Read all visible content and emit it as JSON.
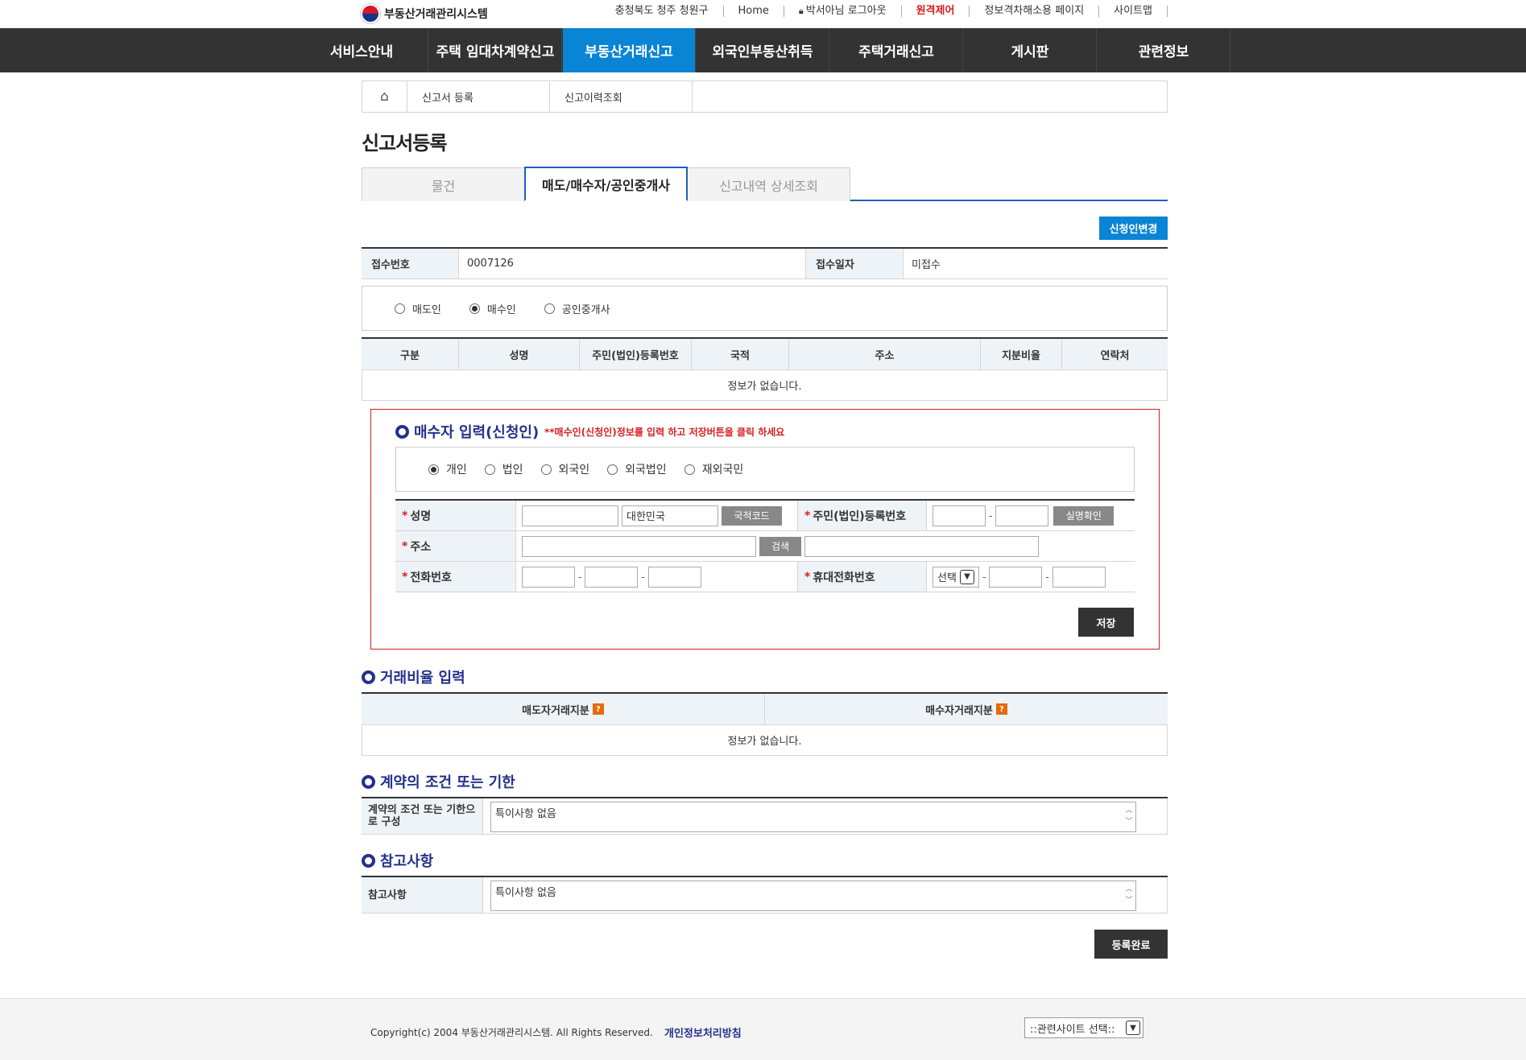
{
  "header": {
    "logo_text": "부동산거래관리시스템",
    "region": "충청북도 청주 청원구",
    "home": "Home",
    "user": "박서아님 로그아웃",
    "remote": "원격제어",
    "accessibility": "정보격차해소용 페이지",
    "sitemap": "사이트맵"
  },
  "gnb": [
    "서비스안내",
    "주택 임대차계약신고",
    "부동산거래신고",
    "외국인부동산취득",
    "주택거래신고",
    "게시판",
    "관련정보"
  ],
  "gnb_active_index": 2,
  "breadcrumb": {
    "home_icon": "home-icon",
    "items": [
      "신고서 등록",
      "신고이력조회"
    ]
  },
  "page_title": "신고서등록",
  "tabs": [
    "물건",
    "매도/매수자/공인중개사",
    "신고내역 상세조회"
  ],
  "tabs_active_index": 1,
  "change_applicant_button": "신청인변경",
  "receipt": {
    "number_label": "접수번호",
    "number_value": "0007126",
    "date_label": "접수일자",
    "date_value": "미접수"
  },
  "roles": {
    "options": [
      "매도인",
      "매수인",
      "공인중개사"
    ],
    "selected_index": 1
  },
  "party_table": {
    "columns": [
      "구분",
      "성명",
      "주민(법인)등록번호",
      "국적",
      "주소",
      "지분비율",
      "연락처"
    ],
    "empty_message": "정보가 없습니다."
  },
  "buyer_form": {
    "title": "매수자 입력(신청인)",
    "note": "**매수인(신청인)정보를 입력 하고 저장버튼을 클릭 하세요",
    "types": {
      "options": [
        "개인",
        "법인",
        "외국인",
        "외국법인",
        "재외국민"
      ],
      "selected_index": 0
    },
    "name_label": "성명",
    "country_value": "대한민국",
    "country_code_button": "국적코드",
    "id_label": "주민(법인)등록번호",
    "verify_button": "실명확인",
    "address_label": "주소",
    "search_button": "검색",
    "phone_label": "전화번호",
    "mobile_label": "휴대전화번호",
    "mobile_select": "선택",
    "save_button": "저장"
  },
  "ratio": {
    "title": "거래비율 입력",
    "seller_col": "매도자거래지분",
    "buyer_col": "매수자거래지분",
    "help_icon": "?",
    "empty_message": "정보가 없습니다."
  },
  "conditions": {
    "title": "계약의 조건 또는 기한",
    "label": "계약의 조건 또는 기한으로 구성",
    "value": "특이사항 없음"
  },
  "notes": {
    "title": "참고사항",
    "label": "참고사항",
    "value": "특이사항 없음"
  },
  "complete_button": "등록완료",
  "footer": {
    "copyright": "Copyright(c) 2004 부동산거래관리시스템. All Rights Reserved.",
    "privacy": "개인정보처리방침",
    "related_select": "::관련사이트 선택::"
  },
  "colors": {
    "accent": "#0a84d4",
    "nav_bg": "#333333",
    "section_title": "#24318c",
    "warning": "#d41f1f"
  }
}
